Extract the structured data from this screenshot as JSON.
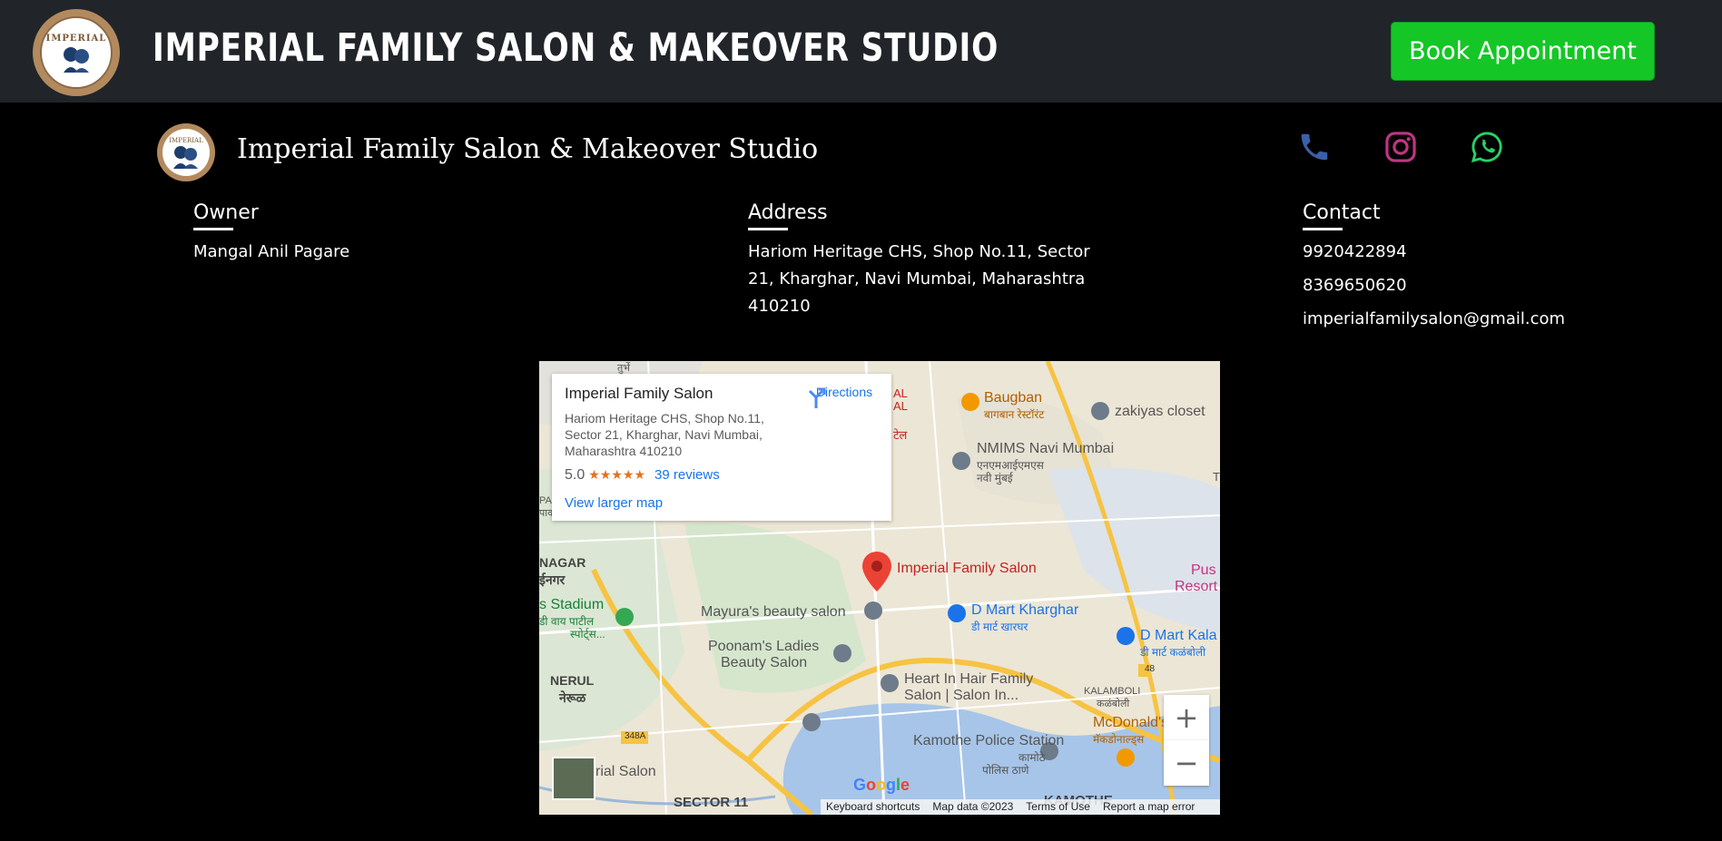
{
  "navbar": {
    "logo_text": "IMPERIAL",
    "title": "IMPERIAL FAMILY SALON & MAKEOVER STUDIO",
    "book_label": "Book Appointment"
  },
  "footer": {
    "logo_text": "IMPERIAL",
    "name": "Imperial Family Salon & Makeover Studio",
    "social": [
      "phone-icon",
      "instagram-icon",
      "whatsapp-icon"
    ],
    "owner": {
      "heading": "Owner",
      "value": "Mangal Anil Pagare"
    },
    "address": {
      "heading": "Address",
      "lines": [
        "Hariom Heritage CHS, Shop No.11, Sector",
        "21, Kharghar, Navi Mumbai, Maharashtra",
        "410210"
      ]
    },
    "contact": {
      "heading": "Contact",
      "phone1": "9920422894",
      "phone2": "8369650620",
      "email": "imperialfamilysalon@gmail.com"
    }
  },
  "map": {
    "card": {
      "name": "Imperial Family Salon",
      "address": "Hariom Heritage CHS, Shop No.11, Sector 21, Kharghar, Navi Mumbai, Maharashtra 410210",
      "rating": "5.0",
      "stars": "★★★★★",
      "reviews": "39 reviews",
      "larger_map": "View larger map",
      "directions": "Directions"
    },
    "labels": {
      "baugban": "Baugban",
      "baugban_hi": "बागबान रेस्टॉरंट",
      "zakiyas": "zakiyas closet",
      "nmims": "NMIMS Navi Mumbai",
      "nmims_hi": "एनएमआईएमएस",
      "nmims_hi2": "नवी मुंबई",
      "marker": "Imperial Family Salon",
      "mayura": "Mayura's beauty salon",
      "dmart": "D Mart Kharghar",
      "dmart_hi": "डी मार्ट खारघर",
      "dmart2": "D Mart Kala",
      "dmart2_hi": "डी मार्ट कळंबोली",
      "poonam1": "Poonam's Ladies",
      "poonam2": "Beauty Salon",
      "heart1": "Heart In Hair Family",
      "heart2": "Salon | Salon In...",
      "nagar": "NAGAR",
      "nagar_hi": "ईनगर",
      "stadium": "s Stadium",
      "stadium_hi": "डी वाय पाटील",
      "stadium_hi2": "स्पोर्ट्स...",
      "nerul": "NERUL",
      "nerul_hi": "नेरूळ",
      "kamothe_ps": "Kamothe Police Station",
      "kamothe_ps_hi": "कामोठे",
      "kamothe_ps_hi2": "पोलिस ठाणे",
      "mcd": "McDonald's",
      "mcd_hi": "मॅकडोनाल्ड्स",
      "kalamboli": "KALAMBOLI",
      "kalamboli_hi": "कळंबोली",
      "sector11": "SECTOR 11",
      "kamothe": "KAMOTHE",
      "rial_salon": "rial Salon",
      "pus": "Pus",
      "resort": "Resort",
      "al1": "AL",
      "al2": "AL",
      "tel": "टेल",
      "road48": "48",
      "road348a": "348A",
      "pa": "PA",
      "paa": "पाव",
      "top": "तुर्भे",
      "t": "T"
    },
    "zoom_in": "+",
    "zoom_out": "−",
    "google": "Google",
    "attribution": [
      "Keyboard shortcuts",
      "Map data ©2023",
      "Terms of Use",
      "Report a map error"
    ]
  },
  "colors": {
    "navbar_bg": "#212529",
    "book_button": "#15c627",
    "phone": "#3b5fa8",
    "instagram": "#c13584",
    "whatsapp": "#25d366"
  }
}
